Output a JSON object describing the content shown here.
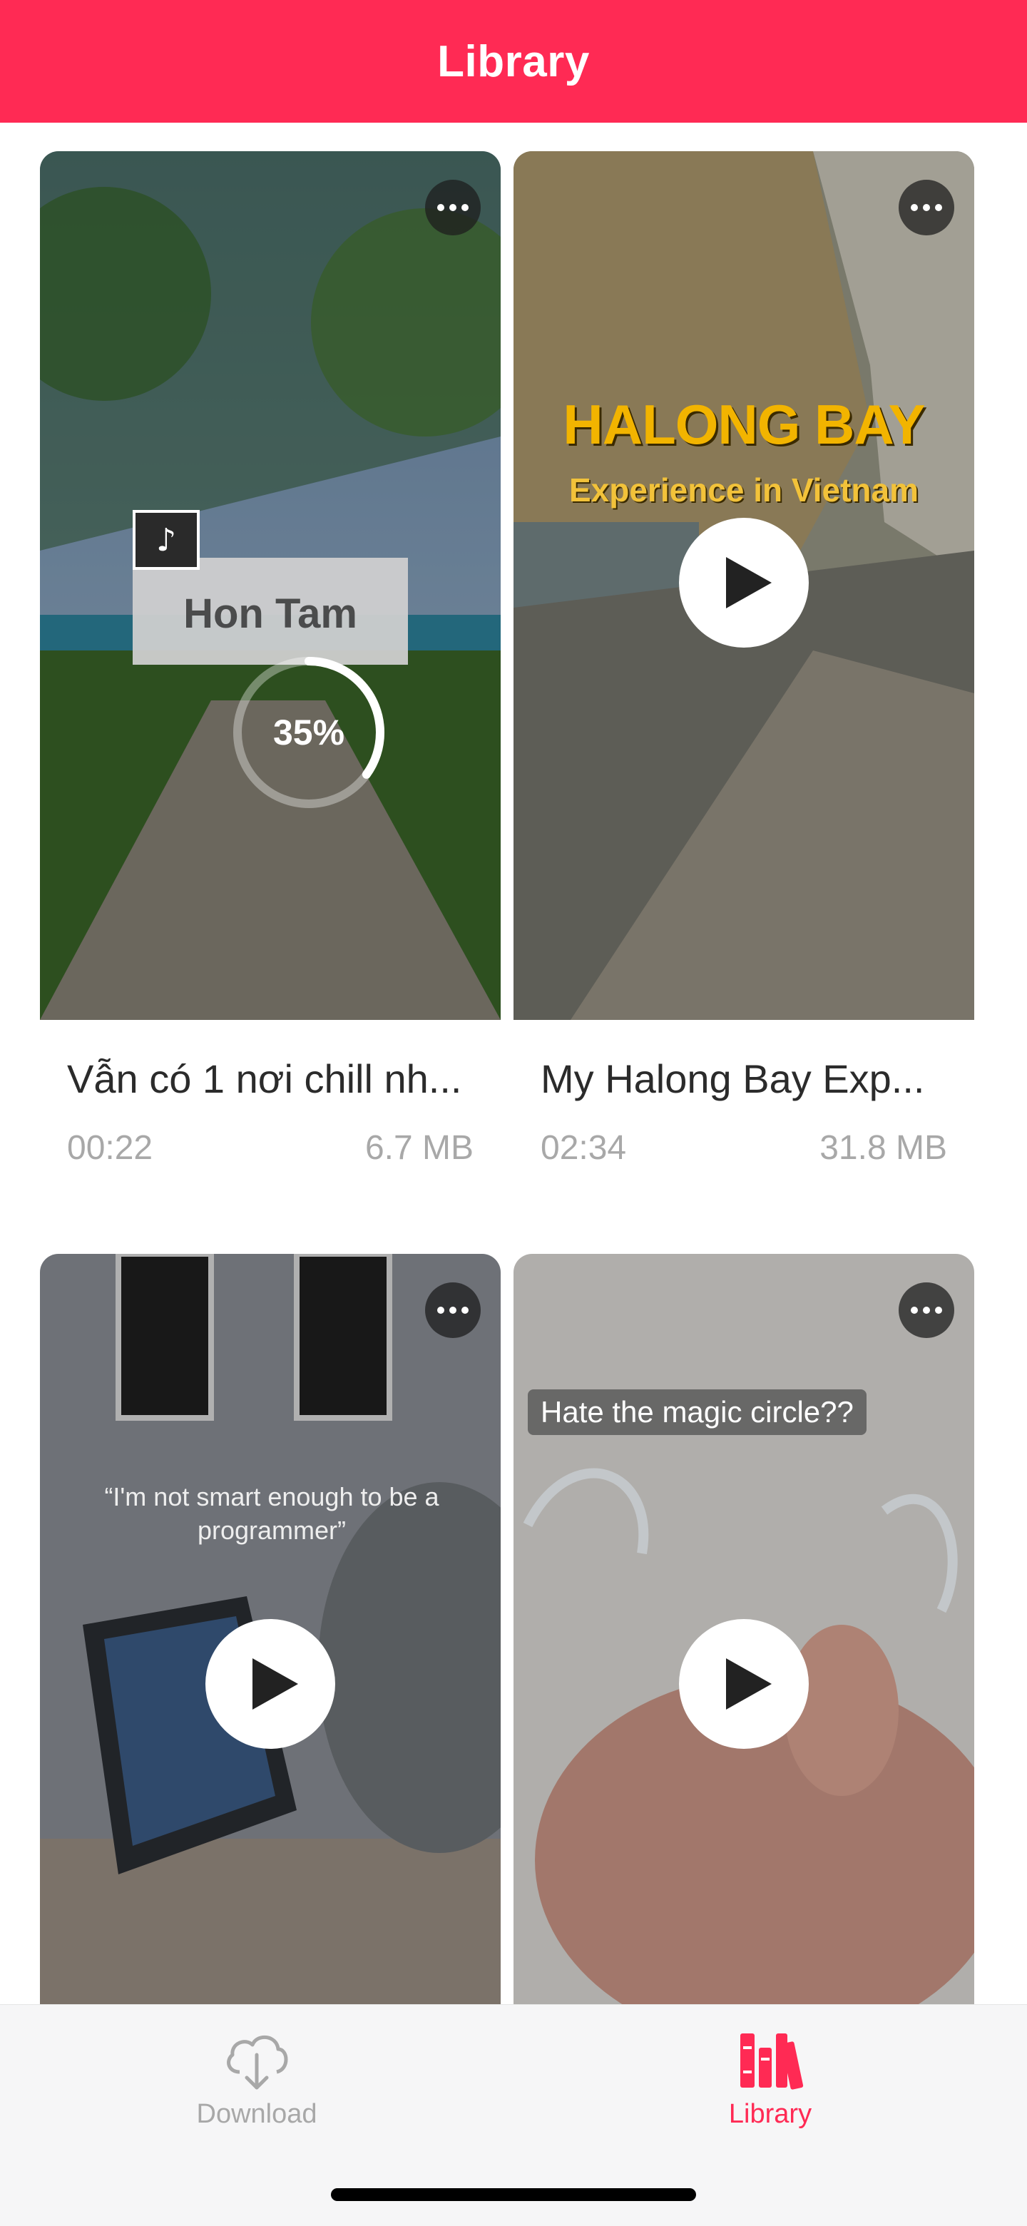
{
  "header": {
    "title": "Library"
  },
  "videos": [
    {
      "title": "Vẫn có 1 nơi chill nh...",
      "duration": "00:22",
      "size": "6.7 MB",
      "progress_percent": 35,
      "progress_label": "35%",
      "overlay_text": "Hon Tam"
    },
    {
      "title": "My Halong Bay Exp...",
      "duration": "02:34",
      "size": "31.8 MB",
      "overlay_title": "HALONG BAY",
      "overlay_subtitle": "Experience in Vietnam"
    },
    {
      "overlay_text": "“I'm not smart enough to be a programmer”"
    },
    {
      "overlay_text": "Hate the magic circle??"
    }
  ],
  "tabs": [
    {
      "label": "Download",
      "icon": "cloud-download-icon",
      "active": false
    },
    {
      "label": "Library",
      "icon": "library-books-icon",
      "active": true
    }
  ],
  "colors": {
    "accent": "#ff2a54",
    "inactive": "#a8a8a8"
  }
}
